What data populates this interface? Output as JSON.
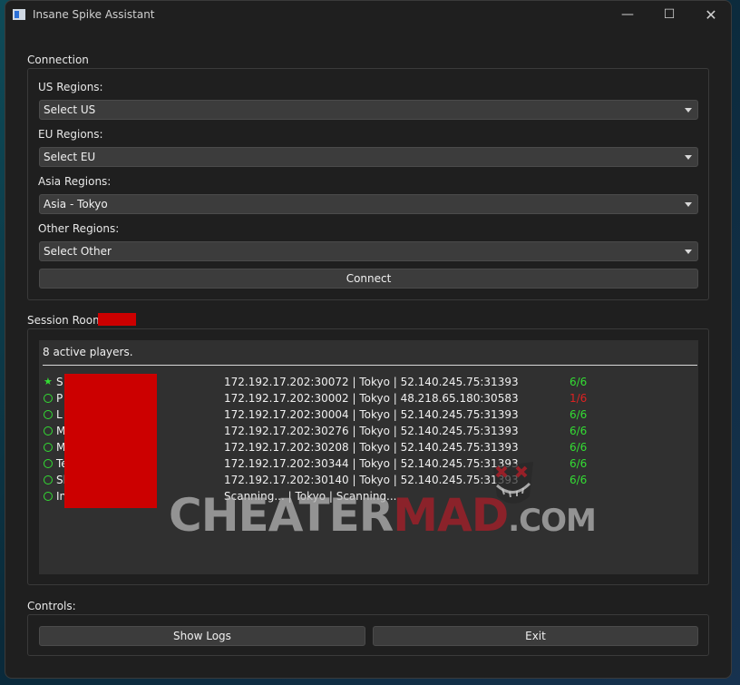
{
  "window": {
    "title": "Insane Spike Assistant",
    "controls": {
      "minimize": "—",
      "maximize": "☐",
      "close": "✕"
    }
  },
  "connection": {
    "section_label": "Connection",
    "us": {
      "label": "US Regions:",
      "value": "Select US"
    },
    "eu": {
      "label": "EU Regions:",
      "value": "Select EU"
    },
    "asia": {
      "label": "Asia Regions:",
      "value": "Asia - Tokyo"
    },
    "other": {
      "label": "Other Regions:",
      "value": "Select Other"
    },
    "connect_label": "Connect"
  },
  "session": {
    "label": "Session Room:",
    "active_players": "8 active players.",
    "players": [
      {
        "icon": "star-icon",
        "name": "S",
        "info": "172.192.17.202:30072 | Tokyo | 52.140.245.75:31393",
        "slots": "6/6",
        "slot_color": "#33dd33"
      },
      {
        "icon": "ring-icon",
        "name": "P",
        "info": "172.192.17.202:30002 | Tokyo | 48.218.65.180:30583",
        "slots": "1/6",
        "slot_color": "#dd2222"
      },
      {
        "icon": "ring-icon",
        "name": "L",
        "info": "172.192.17.202:30004 | Tokyo | 52.140.245.75:31393",
        "slots": "6/6",
        "slot_color": "#33dd33"
      },
      {
        "icon": "ring-icon",
        "name": "M",
        "info": "172.192.17.202:30276 | Tokyo | 52.140.245.75:31393",
        "slots": "6/6",
        "slot_color": "#33dd33"
      },
      {
        "icon": "ring-icon",
        "name": "M",
        "info": "172.192.17.202:30208 | Tokyo | 52.140.245.75:31393",
        "slots": "6/6",
        "slot_color": "#33dd33"
      },
      {
        "icon": "ring-icon",
        "name": "Te",
        "info": "172.192.17.202:30344 | Tokyo | 52.140.245.75:31393",
        "slots": "6/6",
        "slot_color": "#33dd33"
      },
      {
        "icon": "ring-icon",
        "name": "Sl",
        "info": "172.192.17.202:30140 | Tokyo | 52.140.245.75:31393",
        "slots": "6/6",
        "slot_color": "#33dd33"
      },
      {
        "icon": "ring-icon",
        "name": "In",
        "info": "Scanning... | Tokyo | Scanning...",
        "slots": "",
        "slot_color": "#33dd33"
      }
    ]
  },
  "controls": {
    "section_label": "Controls:",
    "show_logs_label": "Show Logs",
    "exit_label": "Exit"
  },
  "watermark": {
    "part1": "CHEATER",
    "part2": "MAD",
    "part3": ".COM"
  },
  "colors": {
    "redaction": "#cc0000",
    "status_ok": "#33dd33",
    "status_bad": "#dd2222"
  }
}
